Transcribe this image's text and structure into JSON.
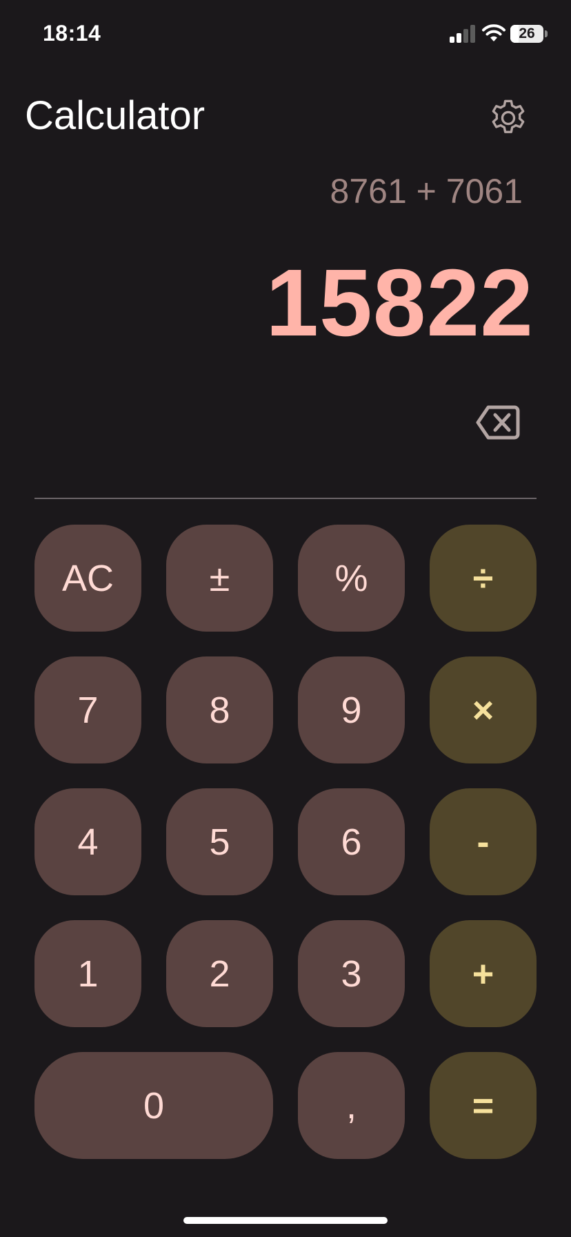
{
  "status_bar": {
    "time": "18:14",
    "battery_percent": "26",
    "battery_level": 0.26,
    "signal_icon": "cellular-signal-icon",
    "wifi_icon": "wifi-icon",
    "battery_icon": "battery-icon"
  },
  "header": {
    "title": "Calculator",
    "settings_icon": "gear-icon"
  },
  "display": {
    "expression": "8761 + 7061",
    "result": "15822",
    "backspace_icon": "backspace-icon"
  },
  "keypad": {
    "rows": [
      [
        "AC",
        "±",
        "%",
        "÷"
      ],
      [
        "7",
        "8",
        "9",
        "×"
      ],
      [
        "4",
        "5",
        "6",
        "-"
      ],
      [
        "1",
        "2",
        "3",
        "+"
      ],
      [
        "0",
        ",",
        "="
      ]
    ]
  },
  "colors": {
    "background": "#1b181b",
    "number_key": "#5a4341",
    "operator_key": "#51462a",
    "result_text": "#ffb4a9",
    "expression_text": "#9f8582"
  }
}
